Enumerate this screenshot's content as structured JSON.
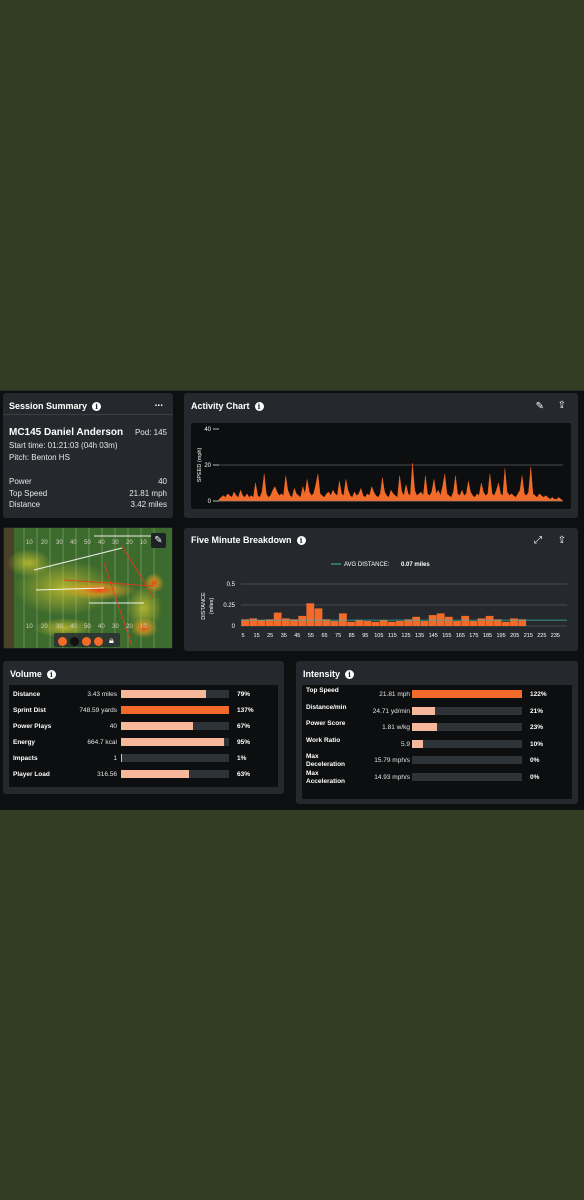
{
  "colors": {
    "accent": "#f26b2a",
    "accent_light": "#f7b79a",
    "background": "#333d24",
    "card": "#25292d",
    "teal": "#3bb3a8"
  },
  "session_summary": {
    "title": "Session Summary",
    "menu_label": "...",
    "player_name": "MC145 Daniel Anderson",
    "pod": "Pod: 145",
    "start_time": "Start time: 01:21:03 (04h 03m)",
    "pitch": "Pitch: Benton HS",
    "rows": [
      {
        "label": "Power",
        "value": "40"
      },
      {
        "label": "Top Speed",
        "value": "21.81 mph"
      },
      {
        "label": "Distance",
        "value": "3.42 miles"
      }
    ]
  },
  "heatmap": {
    "edit_icon": "pencil-icon",
    "lock_icon": "lock-icon",
    "top_yard_labels": [
      "10",
      "20",
      "30",
      "40",
      "50",
      "40",
      "30",
      "20",
      "10"
    ],
    "bottom_yard_labels": [
      "10",
      "20",
      "30",
      "40",
      "50",
      "40",
      "30",
      "20",
      "10"
    ],
    "dot_colors": [
      "#f26b2a",
      "#111111",
      "#f26b2a",
      "#f26b2a"
    ]
  },
  "activity_chart": {
    "title": "Activity Chart",
    "edit_icon": "pencil-icon",
    "export_icon": "upload-icon",
    "chart_data": {
      "type": "area",
      "ylabel": "SPEED (mph)",
      "yticks": [
        "40",
        "20",
        "0"
      ],
      "ylim": [
        0,
        40
      ],
      "values": [
        1,
        2,
        3,
        2,
        4,
        3,
        2,
        5,
        3,
        2,
        6,
        3,
        2,
        4,
        2,
        3,
        2,
        10,
        3,
        2,
        5,
        15,
        4,
        2,
        3,
        6,
        8,
        5,
        3,
        4,
        3,
        14,
        6,
        3,
        2,
        7,
        4,
        3,
        2,
        8,
        4,
        12,
        5,
        3,
        4,
        9,
        15,
        4,
        3,
        2,
        4,
        5,
        3,
        6,
        4,
        3,
        11,
        4,
        3,
        12,
        6,
        3,
        2,
        5,
        3,
        4,
        7,
        3,
        2,
        4,
        3,
        8,
        5,
        3,
        2,
        4,
        13,
        5,
        3,
        2,
        6,
        4,
        3,
        2,
        14,
        5,
        3,
        9,
        4,
        3,
        21,
        6,
        3,
        4,
        5,
        3,
        14,
        4,
        3,
        5,
        12,
        4,
        6,
        3,
        8,
        15,
        4,
        3,
        2,
        5,
        14,
        4,
        3,
        6,
        3,
        4,
        11,
        5,
        3,
        2,
        4,
        3,
        10,
        5,
        3,
        4,
        15,
        4,
        3,
        6,
        10,
        4,
        3,
        18,
        5,
        3,
        4,
        3,
        2,
        4,
        6,
        14,
        4,
        3,
        5,
        19,
        4,
        3,
        2,
        4,
        3,
        2,
        3,
        2,
        1,
        2,
        1,
        1,
        2,
        1,
        0
      ]
    }
  },
  "five_minute": {
    "title": "Five Minute Breakdown",
    "expand_icon": "expand-icon",
    "export_icon": "upload-icon",
    "legend": "AVG DISTANCE:",
    "legend_value": "0.07 miles",
    "chart_data": {
      "type": "bar",
      "ylabel": "DISTANCE (miles)",
      "ylim": [
        0,
        0.5
      ],
      "yticks": [
        "0.5",
        "0.25",
        "0"
      ],
      "avg": 0.07,
      "x_labels": [
        "5",
        "15",
        "25",
        "35",
        "45",
        "55",
        "65",
        "75",
        "85",
        "95",
        "105",
        "115",
        "125",
        "135",
        "145",
        "155",
        "165",
        "175",
        "185",
        "195",
        "205",
        "215",
        "225",
        "235"
      ],
      "values": [
        0.08,
        0.09,
        0.07,
        0.08,
        0.16,
        0.09,
        0.08,
        0.12,
        0.27,
        0.21,
        0.08,
        0.06,
        0.15,
        0.05,
        0.07,
        0.06,
        0.05,
        0.07,
        0.05,
        0.06,
        0.08,
        0.11,
        0.06,
        0.13,
        0.15,
        0.11,
        0.06,
        0.12,
        0.06,
        0.09,
        0.12,
        0.08,
        0.05,
        0.09,
        0.08,
        0.0,
        0.0,
        0.0,
        0.0,
        0.0
      ]
    }
  },
  "volume": {
    "title": "Volume",
    "rows": [
      {
        "label": "Distance",
        "value": "3.43 miles",
        "pct": "79%",
        "fill": 0.79,
        "color": "#f7b79a"
      },
      {
        "label": "Sprint Dist",
        "value": "748.59 yards",
        "pct": "137%",
        "fill": 1.0,
        "color": "#f26b2a"
      },
      {
        "label": "Power Plays",
        "value": "40",
        "pct": "67%",
        "fill": 0.67,
        "color": "#f7b79a"
      },
      {
        "label": "Energy",
        "value": "664.7 kcal",
        "pct": "95%",
        "fill": 0.95,
        "color": "#f7b79a"
      },
      {
        "label": "Impacts",
        "value": "1",
        "pct": "1%",
        "fill": 0.01,
        "color": "#f7b79a"
      },
      {
        "label": "Player Load",
        "value": "316.56",
        "pct": "63%",
        "fill": 0.63,
        "color": "#f7b79a"
      }
    ]
  },
  "intensity": {
    "title": "Intensity",
    "rows": [
      {
        "label": "Top Speed",
        "value": "21.81 mph",
        "pct": "122%",
        "fill": 1.0,
        "color": "#f26b2a"
      },
      {
        "label": "Distance/min",
        "value": "24.71 yd/min",
        "pct": "21%",
        "fill": 0.21,
        "color": "#f7b79a"
      },
      {
        "label": "Power Score",
        "value": "1.81 w/kg",
        "pct": "23%",
        "fill": 0.23,
        "color": "#f7b79a"
      },
      {
        "label": "Work Ratio",
        "value": "5.9",
        "pct": "10%",
        "fill": 0.1,
        "color": "#f7b79a"
      },
      {
        "label": "Max Deceleration",
        "value": "15.79 mph/s",
        "pct": "0%",
        "fill": 0.0,
        "color": "#f7b79a"
      },
      {
        "label": "Max Acceleration",
        "value": "14.93 mph/s",
        "pct": "0%",
        "fill": 0.0,
        "color": "#f7b79a"
      }
    ]
  }
}
